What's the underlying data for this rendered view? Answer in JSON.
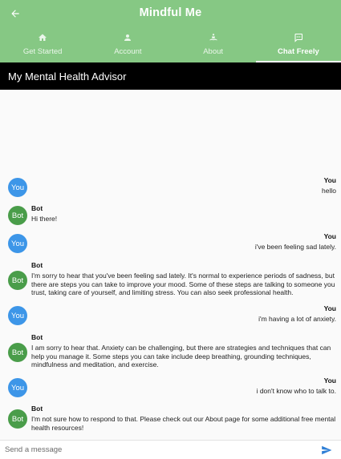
{
  "app": {
    "title": "Mindful Me"
  },
  "tabs": [
    {
      "label": "Get Started",
      "icon": "home-icon"
    },
    {
      "label": "Account",
      "icon": "person-icon"
    },
    {
      "label": "About",
      "icon": "meditation-icon"
    },
    {
      "label": "Chat Freely",
      "icon": "chat-icon",
      "active": true
    }
  ],
  "header": {
    "title": "My Mental Health Advisor"
  },
  "avatars": {
    "user": "You",
    "bot": "Bot"
  },
  "messages": [
    {
      "sender": "You",
      "text": "hello"
    },
    {
      "sender": "Bot",
      "text": "Hi there!"
    },
    {
      "sender": "You",
      "text": "i've been feeling sad lately."
    },
    {
      "sender": "Bot",
      "text": "I'm sorry to hear that you've been feeling sad lately. It's normal to experience periods of sadness, but there are steps you can take to improve your mood. Some of these steps are talking to someone you trust, taking care of yourself, and limiting stress. You can also seek professional health."
    },
    {
      "sender": "You",
      "text": "i'm having a lot of anxiety."
    },
    {
      "sender": "Bot",
      "text": "I am sorry to hear that. Anxiety can be challenging, but there are strategies and techniques that can help you manage it. Some steps you can take include deep breathing, grounding techniques, mindfulness and meditation, and exercise."
    },
    {
      "sender": "You",
      "text": "i don't know who to talk to."
    },
    {
      "sender": "Bot",
      "text": "I'm not sure how to respond to that. Please check out our About page for some additional free mental health resources!"
    }
  ],
  "input": {
    "placeholder": "Send a message",
    "value": ""
  },
  "colors": {
    "appbar": "#86c884",
    "user_avatar": "#3d96e8",
    "bot_avatar": "#4a9d4a",
    "send": "#2f7fd6"
  }
}
